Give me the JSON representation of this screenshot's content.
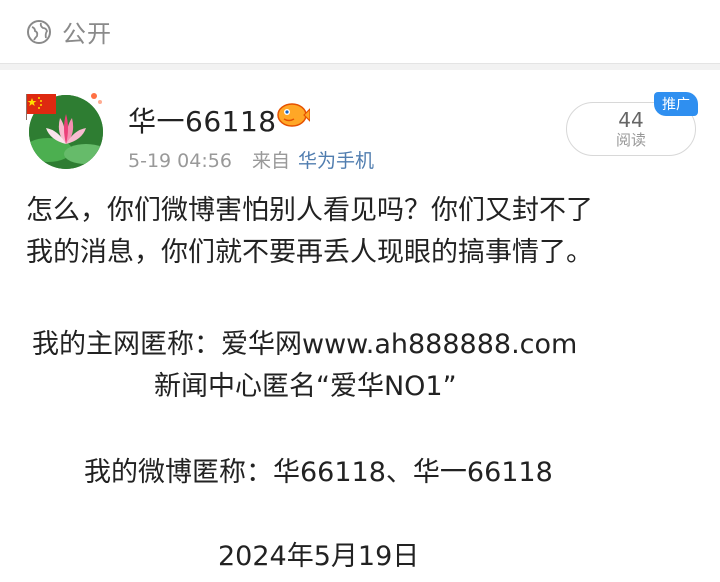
{
  "visibility": {
    "icon": "globe-icon",
    "label": "公开"
  },
  "post": {
    "author": {
      "name": "华一66118",
      "avatar_icon": "lotus-flag-avatar",
      "badge_icon": "vip-fish-icon"
    },
    "timestamp": "5-19 04:56",
    "source_prefix": "来自",
    "source_device": "华为手机",
    "read_count": "44",
    "read_label": "阅读",
    "promote_label": "推广",
    "paragraphs": [
      "怎么，你们微博害怕别人看见吗？你们又封不了",
      "我的消息，你们就不要再丢人现眼的搞事情了。",
      "我的主网匿称：爱华网www.ah888888.com",
      "新闻中心匿名“爱华NO1”",
      "我的微博匿称：华66118、华一66118",
      "2024年5月19日"
    ]
  },
  "colors": {
    "link": "#507daf",
    "meta": "#999999",
    "promote_bg": "#2f8ff0"
  }
}
